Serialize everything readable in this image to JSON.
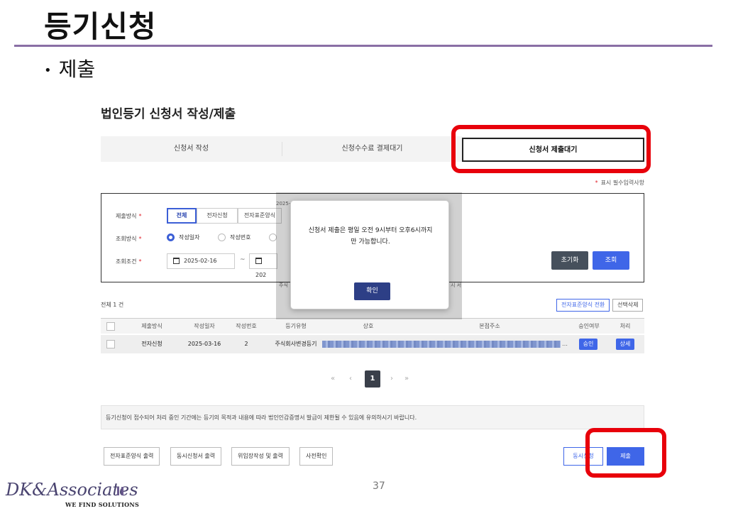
{
  "slide": {
    "title": "등기신청",
    "bullet": "제출",
    "page_number": "37"
  },
  "screen": {
    "page_title": "법인등기 신청서 작성/제출",
    "tabs": [
      {
        "label": "신청서 작성"
      },
      {
        "label": "신청수수료 결제대기"
      },
      {
        "label": "신청서 제출대기",
        "active": true
      }
    ],
    "required_note": "표시 필수입력사항",
    "filter": {
      "submit_method_label": "제출방식",
      "submit_methods": [
        "전체",
        "전자신청",
        "전자표준양식"
      ],
      "search_method_label": "조회방식",
      "search_methods": [
        "작성일자",
        "작성번호"
      ],
      "condition_label": "조회조건",
      "date_from": "2025-02-16",
      "date_to": "202",
      "tilde": "~",
      "reset_label": "초기화",
      "search_label": "조회"
    },
    "total_text": "전체 1 건",
    "convert_button": "전자표준양식 전환",
    "delete_button": "선택삭제",
    "table": {
      "headers": [
        "제출방식",
        "작성일자",
        "작성번호",
        "등기유형",
        "상호",
        "본점주소",
        "승인여부",
        "처리"
      ],
      "rows": [
        {
          "method": "전자신청",
          "date": "2025-03-16",
          "number": "2",
          "type": "주식회사변경등기",
          "approve": "승인",
          "action": "상세"
        }
      ]
    },
    "pager": {
      "first": "«",
      "prev": "‹",
      "current": "1",
      "next": "›",
      "last": "»"
    },
    "notice": "등기신청이 접수되어 처리 중인 기간에는 등기의 목적과 내용에 따라 법인인감증명서 발급이 제한될 수 있음에 유의하시기 바랍니다.",
    "bottom_buttons": [
      "전자표준양식 출력",
      "동시신청서 출력",
      "위임장작성 및 출력",
      "사전확인"
    ],
    "simultaneous_button": "동시신청",
    "submit_button": "제출",
    "ghost_texts": [
      "2025-0",
      "주식",
      "시 서"
    ]
  },
  "modal": {
    "message_line1": "신청서 제출은 평일 오전 9시부터 오후6시까지",
    "message_line2": "만 가능합니다.",
    "ok_label": "확인"
  },
  "logo": {
    "text": "DK&Associates",
    "tagline": "WE FIND SOLUTIONS"
  },
  "colors": {
    "accent": "#3f66e8",
    "highlight": "#e8000b",
    "rule": "#8a6fa5"
  }
}
